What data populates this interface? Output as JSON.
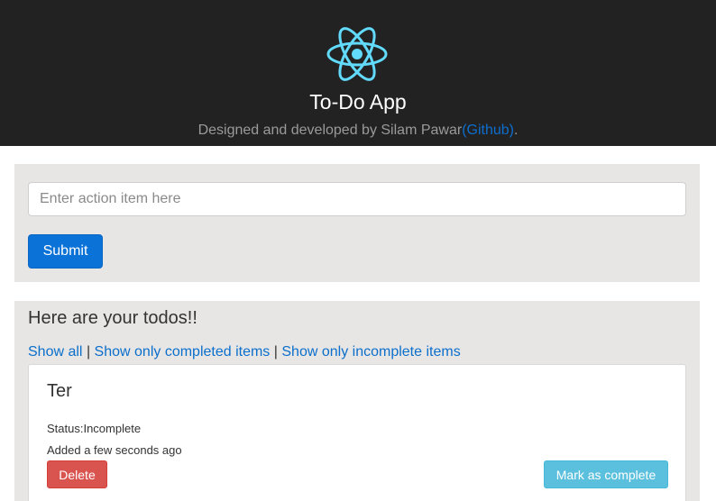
{
  "header": {
    "logo_icon": "react-logo-icon",
    "title": "To-Do App",
    "subtitle_prefix": "Designed and developed by Silam Pawar",
    "github_link": "(Github)",
    "subtitle_suffix": ".",
    "colors": {
      "background": "#222222",
      "logo": "#61dafb",
      "link": "#0d6ecf"
    }
  },
  "form": {
    "input_placeholder": "Enter action item here",
    "input_value": "",
    "submit_label": "Submit",
    "colors": {
      "submit": "#0b72d8"
    }
  },
  "todos": {
    "heading": "Here are your todos!!",
    "filters": [
      {
        "label": "Show all"
      },
      {
        "label": "Show only completed items"
      },
      {
        "label": "Show only incomplete items"
      }
    ],
    "separator": "|",
    "items": [
      {
        "title": "Ter",
        "status": "Status:Incomplete",
        "added": "Added a few seconds ago",
        "delete_label": "Delete",
        "complete_label": "Mark as complete"
      }
    ],
    "colors": {
      "delete": "#d9534f",
      "complete": "#5bc0de"
    }
  }
}
